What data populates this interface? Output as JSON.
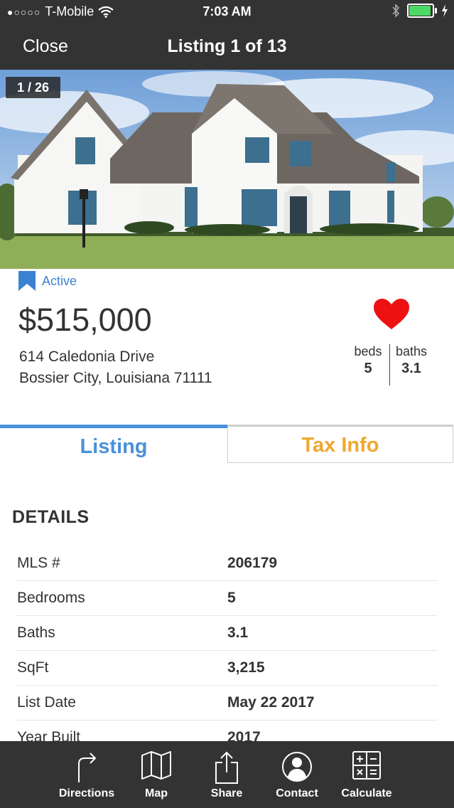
{
  "status_bar": {
    "signal_dots": "●○○○○",
    "carrier": "T-Mobile",
    "time": "7:03 AM",
    "icons": [
      "wifi-icon",
      "bluetooth-icon",
      "battery-icon",
      "charging-icon"
    ]
  },
  "nav": {
    "close_label": "Close",
    "title": "Listing 1 of 13"
  },
  "photo": {
    "counter": "1 / 26"
  },
  "listing": {
    "status": "Active",
    "price": "$515,000",
    "address_line1": "614 Caledonia Drive",
    "address_line2": "Bossier City, Louisiana 71111",
    "beds_label": "beds",
    "beds_value": "5",
    "baths_label": "baths",
    "baths_value": "3.1",
    "favorite_color": "#ee1111"
  },
  "tabs": [
    {
      "label": "Listing",
      "active": true,
      "color": "#4a90d9"
    },
    {
      "label": "Tax Info",
      "active": false,
      "color": "#f0a830"
    }
  ],
  "details": {
    "title": "DETAILS",
    "rows": [
      {
        "label": "MLS #",
        "value": "206179"
      },
      {
        "label": "Bedrooms",
        "value": "5"
      },
      {
        "label": "Baths",
        "value": "3.1"
      },
      {
        "label": "SqFt",
        "value": "3,215"
      },
      {
        "label": "List Date",
        "value": "May 22 2017"
      },
      {
        "label": "Year Built",
        "value": "2017"
      }
    ]
  },
  "toolbar": [
    {
      "label": "Directions",
      "icon": "directions-icon"
    },
    {
      "label": "Map",
      "icon": "map-icon"
    },
    {
      "label": "Share",
      "icon": "share-icon"
    },
    {
      "label": "Contact",
      "icon": "contact-icon"
    },
    {
      "label": "Calculate",
      "icon": "calculator-icon"
    }
  ]
}
